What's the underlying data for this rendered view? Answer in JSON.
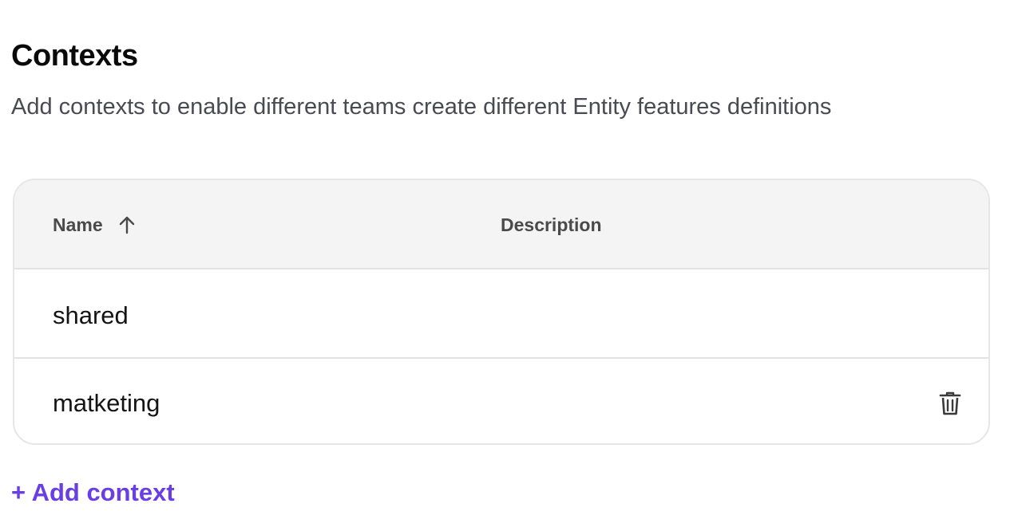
{
  "header": {
    "title": "Contexts",
    "subtitle": "Add contexts to enable different teams create different Entity features definitions"
  },
  "table": {
    "columns": [
      {
        "label": "Name",
        "sort": "ascending",
        "sort_icon": "arrow-up-icon"
      },
      {
        "label": "Description"
      }
    ],
    "rows": [
      {
        "name": "shared",
        "description": "",
        "deletable": false
      },
      {
        "name": "matketing",
        "description": "",
        "deletable": true,
        "action_icon": "trash-icon"
      }
    ]
  },
  "actions": {
    "add_label": "+ Add context"
  },
  "colors": {
    "accent": "#6a3ee6",
    "header_bg": "#f4f4f4",
    "border": "#e2e2e2",
    "subtitle": "#4a4a52"
  }
}
